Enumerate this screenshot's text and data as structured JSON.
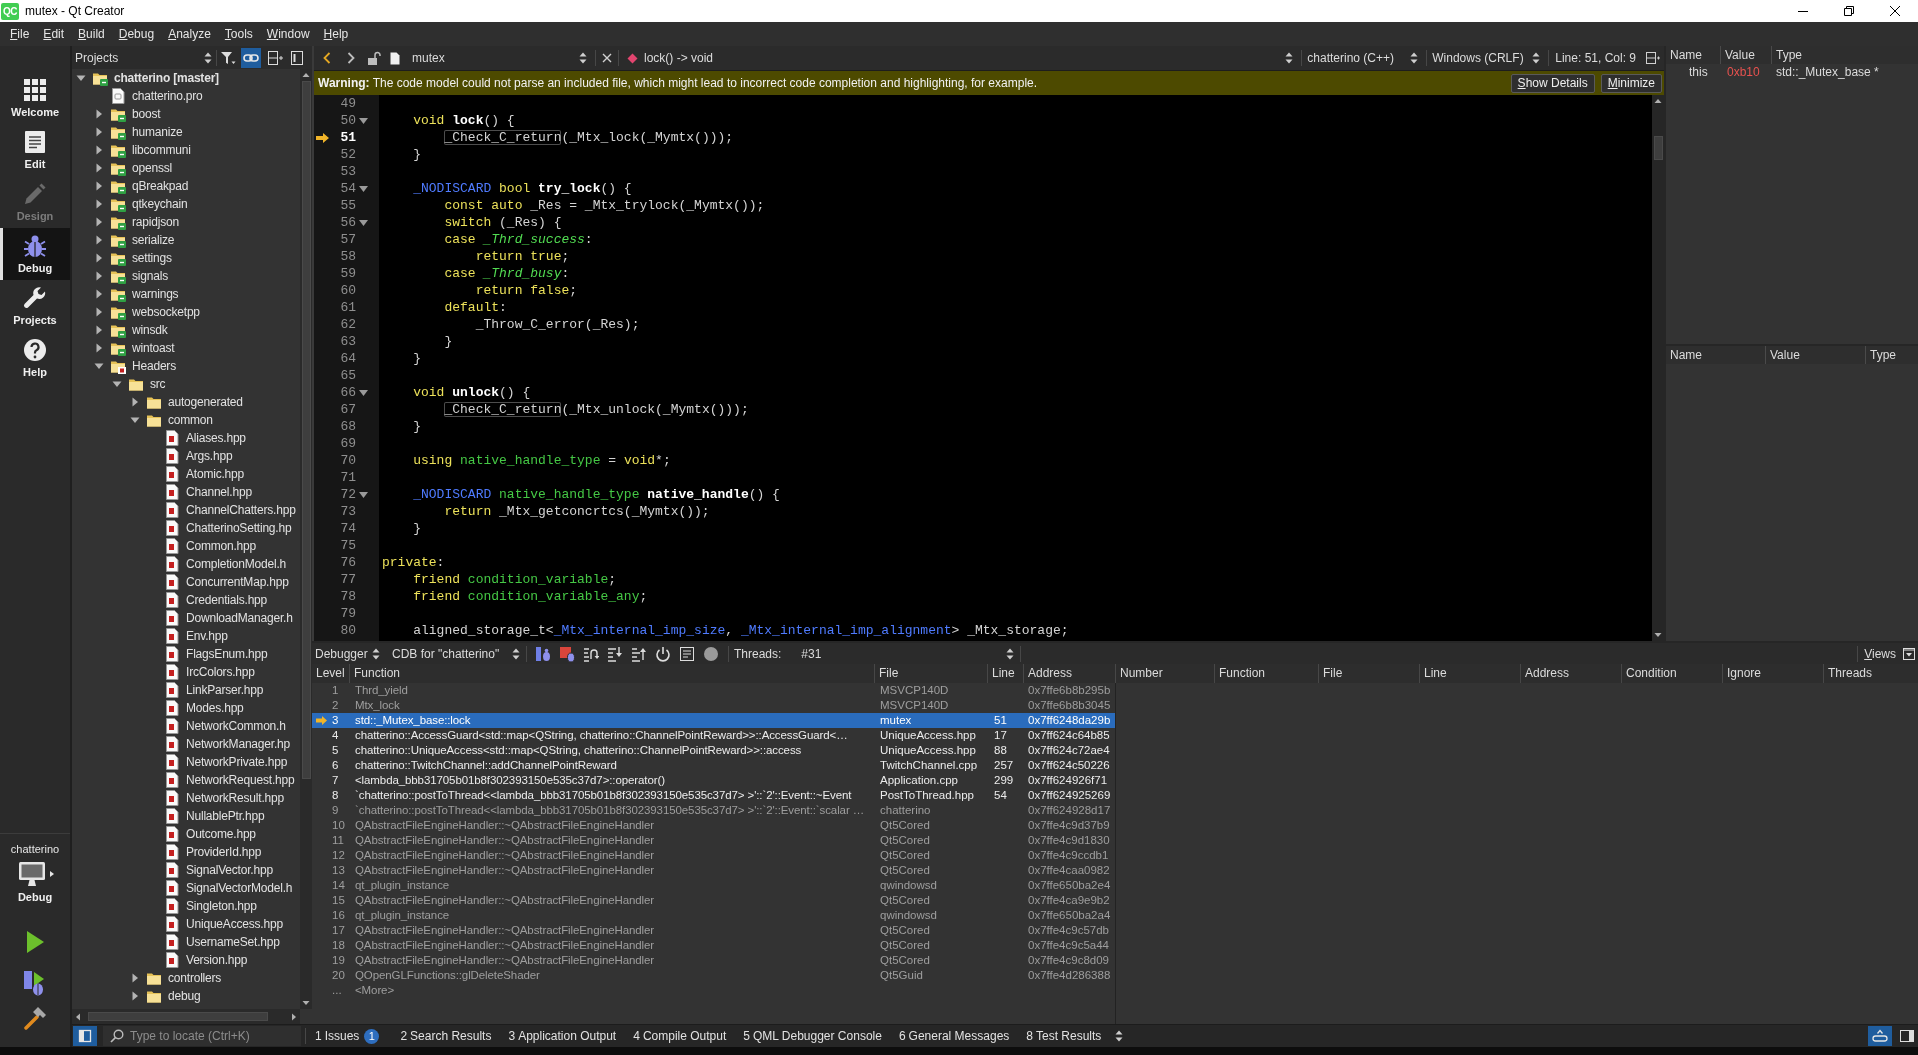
{
  "window": {
    "logo": "QC",
    "title": "mutex - Qt Creator"
  },
  "menu": [
    "File",
    "Edit",
    "Build",
    "Debug",
    "Analyze",
    "Tools",
    "Window",
    "Help"
  ],
  "modes": [
    {
      "kind": "welcome",
      "label": "Welcome",
      "selected": false,
      "disabled": false
    },
    {
      "kind": "edit",
      "label": "Edit",
      "selected": false,
      "disabled": false
    },
    {
      "kind": "design",
      "label": "Design",
      "selected": false,
      "disabled": true
    },
    {
      "kind": "debug",
      "label": "Debug",
      "selected": true,
      "disabled": false
    },
    {
      "kind": "projects",
      "label": "Projects",
      "selected": false,
      "disabled": false
    },
    {
      "kind": "help",
      "label": "Help",
      "selected": false,
      "disabled": false
    }
  ],
  "target": {
    "project": "chatterino",
    "build": "Debug"
  },
  "projects": {
    "view": "Projects",
    "link_with_editor": true,
    "tree": [
      {
        "label": "chatterino [master]",
        "kind": "project",
        "expanded": true,
        "children": [
          {
            "label": "chatterino.pro",
            "kind": "pro-file"
          },
          {
            "label": "boost",
            "kind": "project",
            "expanded": false
          },
          {
            "label": "humanize",
            "kind": "project",
            "expanded": false
          },
          {
            "label": "libcommuni",
            "kind": "project",
            "expanded": false
          },
          {
            "label": "openssl",
            "kind": "project",
            "expanded": false
          },
          {
            "label": "qBreakpad",
            "kind": "project",
            "expanded": false
          },
          {
            "label": "qtkeychain",
            "kind": "project",
            "expanded": false
          },
          {
            "label": "rapidjson",
            "kind": "project",
            "expanded": false
          },
          {
            "label": "serialize",
            "kind": "project",
            "expanded": false
          },
          {
            "label": "settings",
            "kind": "project",
            "expanded": false
          },
          {
            "label": "signals",
            "kind": "project",
            "expanded": false
          },
          {
            "label": "warnings",
            "kind": "project",
            "expanded": false
          },
          {
            "label": "websocketpp",
            "kind": "project",
            "expanded": false
          },
          {
            "label": "winsdk",
            "kind": "project",
            "expanded": false
          },
          {
            "label": "wintoast",
            "kind": "project",
            "expanded": false
          },
          {
            "label": "Headers",
            "kind": "headers",
            "expanded": true,
            "children": [
              {
                "label": "src",
                "kind": "folder",
                "expanded": true,
                "children": [
                  {
                    "label": "autogenerated",
                    "kind": "folder",
                    "expanded": false
                  },
                  {
                    "label": "common",
                    "kind": "folder",
                    "expanded": true,
                    "children": [
                      {
                        "label": "Aliases.hpp",
                        "kind": "header"
                      },
                      {
                        "label": "Args.hpp",
                        "kind": "header"
                      },
                      {
                        "label": "Atomic.hpp",
                        "kind": "header"
                      },
                      {
                        "label": "Channel.hpp",
                        "kind": "header"
                      },
                      {
                        "label": "ChannelChatters.hpp",
                        "kind": "header"
                      },
                      {
                        "label": "ChatterinoSetting.hp",
                        "kind": "header"
                      },
                      {
                        "label": "Common.hpp",
                        "kind": "header"
                      },
                      {
                        "label": "CompletionModel.h",
                        "kind": "header"
                      },
                      {
                        "label": "ConcurrentMap.hpp",
                        "kind": "header"
                      },
                      {
                        "label": "Credentials.hpp",
                        "kind": "header"
                      },
                      {
                        "label": "DownloadManager.h",
                        "kind": "header"
                      },
                      {
                        "label": "Env.hpp",
                        "kind": "header"
                      },
                      {
                        "label": "FlagsEnum.hpp",
                        "kind": "header"
                      },
                      {
                        "label": "IrcColors.hpp",
                        "kind": "header"
                      },
                      {
                        "label": "LinkParser.hpp",
                        "kind": "header"
                      },
                      {
                        "label": "Modes.hpp",
                        "kind": "header"
                      },
                      {
                        "label": "NetworkCommon.h",
                        "kind": "header"
                      },
                      {
                        "label": "NetworkManager.hp",
                        "kind": "header"
                      },
                      {
                        "label": "NetworkPrivate.hpp",
                        "kind": "header"
                      },
                      {
                        "label": "NetworkRequest.hpp",
                        "kind": "header"
                      },
                      {
                        "label": "NetworkResult.hpp",
                        "kind": "header"
                      },
                      {
                        "label": "NullablePtr.hpp",
                        "kind": "header"
                      },
                      {
                        "label": "Outcome.hpp",
                        "kind": "header"
                      },
                      {
                        "label": "ProviderId.hpp",
                        "kind": "header"
                      },
                      {
                        "label": "SignalVector.hpp",
                        "kind": "header"
                      },
                      {
                        "label": "SignalVectorModel.h",
                        "kind": "header"
                      },
                      {
                        "label": "Singleton.hpp",
                        "kind": "header"
                      },
                      {
                        "label": "UniqueAccess.hpp",
                        "kind": "header"
                      },
                      {
                        "label": "UsernameSet.hpp",
                        "kind": "header"
                      },
                      {
                        "label": "Version.hpp",
                        "kind": "header"
                      }
                    ]
                  },
                  {
                    "label": "controllers",
                    "kind": "folder",
                    "expanded": false
                  },
                  {
                    "label": "debug",
                    "kind": "folder",
                    "expanded": false
                  }
                ]
              }
            ]
          }
        ]
      }
    ]
  },
  "editor": {
    "file": "mutex",
    "symbol": "lock() -> void",
    "language": "chatterino (C++)",
    "line_endings": "Windows (CRLF)",
    "position": "Line: 51, Col: 9",
    "warning": {
      "message": "**Warning:** The code model could not parse an included file, which might lead to incorrect code completion and highlighting, for example.",
      "buttons": [
        "Show Details",
        "Minimize"
      ]
    },
    "lines": [
      {
        "number": "49",
        "fold": false,
        "current": false
      },
      {
        "number": "50",
        "fold": true,
        "current": false,
        "tokens": [
          {
            "text": "    void ",
            "kind": "keyword"
          },
          {
            "text": "lock",
            "kind": "function"
          },
          {
            "text": "() {",
            "kind": "plain"
          }
        ]
      },
      {
        "number": "51",
        "fold": false,
        "current": true,
        "tokens": [
          {
            "text": "        _Check_C_return",
            "kind": "boxed"
          },
          {
            "text": "(_Mtx_lock(_Mymtx()));",
            "kind": "plain"
          }
        ]
      },
      {
        "number": "52",
        "fold": false,
        "current": false,
        "tokens": [
          {
            "text": "    }",
            "kind": "plain"
          }
        ]
      },
      {
        "number": "53",
        "fold": false,
        "current": false
      },
      {
        "number": "54",
        "fold": true,
        "current": false,
        "tokens": [
          {
            "text": "    _NODISCARD",
            "kind": "macro"
          },
          {
            "text": " bool ",
            "kind": "keyword"
          },
          {
            "text": "try_lock",
            "kind": "function"
          },
          {
            "text": "() {",
            "kind": "plain"
          }
        ]
      },
      {
        "number": "55",
        "fold": false,
        "current": false,
        "tokens": [
          {
            "text": "        const auto ",
            "kind": "keyword"
          },
          {
            "text": "_Res = _Mtx_trylock(_Mymtx());",
            "kind": "plain"
          }
        ]
      },
      {
        "number": "56",
        "fold": true,
        "current": false,
        "tokens": [
          {
            "text": "        switch",
            "kind": "keyword"
          },
          {
            "text": " (_Res) {",
            "kind": "plain"
          }
        ]
      },
      {
        "number": "57",
        "fold": false,
        "current": false,
        "tokens": [
          {
            "text": "        case ",
            "kind": "keyword"
          },
          {
            "text": "_Thrd_success",
            "kind": "enum"
          },
          {
            "text": ":",
            "kind": "plain"
          }
        ]
      },
      {
        "number": "58",
        "fold": false,
        "current": false,
        "tokens": [
          {
            "text": "            return true",
            "kind": "keyword"
          },
          {
            "text": ";",
            "kind": "plain"
          }
        ]
      },
      {
        "number": "59",
        "fold": false,
        "current": false,
        "tokens": [
          {
            "text": "        case ",
            "kind": "keyword"
          },
          {
            "text": "_Thrd_busy",
            "kind": "enum"
          },
          {
            "text": ":",
            "kind": "plain"
          }
        ]
      },
      {
        "number": "60",
        "fold": false,
        "current": false,
        "tokens": [
          {
            "text": "            return false",
            "kind": "keyword"
          },
          {
            "text": ";",
            "kind": "plain"
          }
        ]
      },
      {
        "number": "61",
        "fold": false,
        "current": false,
        "tokens": [
          {
            "text": "        default",
            "kind": "keyword"
          },
          {
            "text": ":",
            "kind": "plain"
          }
        ]
      },
      {
        "number": "62",
        "fold": false,
        "current": false,
        "tokens": [
          {
            "text": "            _Throw_C_error(_Res);",
            "kind": "plain"
          }
        ]
      },
      {
        "number": "63",
        "fold": false,
        "current": false,
        "tokens": [
          {
            "text": "        }",
            "kind": "plain"
          }
        ]
      },
      {
        "number": "64",
        "fold": false,
        "current": false,
        "tokens": [
          {
            "text": "    }",
            "kind": "plain"
          }
        ]
      },
      {
        "number": "65",
        "fold": false,
        "current": false
      },
      {
        "number": "66",
        "fold": true,
        "current": false,
        "tokens": [
          {
            "text": "    void ",
            "kind": "keyword"
          },
          {
            "text": "unlock",
            "kind": "function"
          },
          {
            "text": "() {",
            "kind": "plain"
          }
        ]
      },
      {
        "number": "67",
        "fold": false,
        "current": false,
        "tokens": [
          {
            "text": "        _Check_C_return",
            "kind": "boxed"
          },
          {
            "text": "(_Mtx_unlock(_Mymtx()));",
            "kind": "plain"
          }
        ]
      },
      {
        "number": "68",
        "fold": false,
        "current": false,
        "tokens": [
          {
            "text": "    }",
            "kind": "plain"
          }
        ]
      },
      {
        "number": "69",
        "fold": false,
        "current": false
      },
      {
        "number": "70",
        "fold": false,
        "current": false,
        "tokens": [
          {
            "text": "    using ",
            "kind": "keyword"
          },
          {
            "text": "native_handle_type",
            "kind": "type"
          },
          {
            "text": " = ",
            "kind": "plain"
          },
          {
            "text": "void",
            "kind": "keyword"
          },
          {
            "text": "*;",
            "kind": "plain"
          }
        ]
      },
      {
        "number": "71",
        "fold": false,
        "current": false
      },
      {
        "number": "72",
        "fold": true,
        "current": false,
        "tokens": [
          {
            "text": "    _NODISCARD",
            "kind": "macro"
          },
          {
            "text": " native_handle_type ",
            "kind": "type"
          },
          {
            "text": "native_handle",
            "kind": "function"
          },
          {
            "text": "() {",
            "kind": "plain"
          }
        ]
      },
      {
        "number": "73",
        "fold": false,
        "current": false,
        "tokens": [
          {
            "text": "        return ",
            "kind": "keyword"
          },
          {
            "text": "_Mtx_getconcrtcs(_Mymtx());",
            "kind": "plain"
          }
        ]
      },
      {
        "number": "74",
        "fold": false,
        "current": false,
        "tokens": [
          {
            "text": "    }",
            "kind": "plain"
          }
        ]
      },
      {
        "number": "75",
        "fold": false,
        "current": false
      },
      {
        "number": "76",
        "fold": false,
        "current": false,
        "tokens": [
          {
            "text": "private",
            "kind": "keyword"
          },
          {
            "text": ":",
            "kind": "plain"
          }
        ]
      },
      {
        "number": "77",
        "fold": false,
        "current": false,
        "tokens": [
          {
            "text": "    friend ",
            "kind": "keyword"
          },
          {
            "text": "condition_variable",
            "kind": "type"
          },
          {
            "text": ";",
            "kind": "plain"
          }
        ]
      },
      {
        "number": "78",
        "fold": false,
        "current": false,
        "tokens": [
          {
            "text": "    friend ",
            "kind": "keyword"
          },
          {
            "text": "condition_variable_any",
            "kind": "type"
          },
          {
            "text": ";",
            "kind": "plain"
          }
        ]
      },
      {
        "number": "79",
        "fold": false,
        "current": false
      },
      {
        "number": "80",
        "fold": false,
        "current": false,
        "tokens": [
          {
            "text": "    aligned_storage_t<",
            "kind": "plain"
          },
          {
            "text": "_Mtx_internal_imp_size",
            "kind": "macro"
          },
          {
            "text": ", ",
            "kind": "plain"
          },
          {
            "text": "_Mtx_internal_imp_alignment",
            "kind": "macro"
          },
          {
            "text": "> _Mtx_storage;",
            "kind": "plain"
          }
        ]
      }
    ]
  },
  "locals": {
    "columns": [
      "Name",
      "Value",
      "Type"
    ],
    "rows": [
      {
        "name": "this",
        "value": "0xb10",
        "type": "std::_Mutex_base *",
        "changed": true
      }
    ]
  },
  "inspector": {
    "columns": [
      "Name",
      "Value",
      "Type"
    ]
  },
  "debugger": {
    "perspective": "Debugger",
    "engine": "CDB for \"chatterino\"",
    "threads_label": "Threads:",
    "thread": "#31",
    "views": "Views",
    "stack": {
      "columns": [
        "Level",
        "Function",
        "File",
        "Line",
        "Address"
      ],
      "frames": [
        {
          "level": "1",
          "function": "Thrd_yield",
          "file": "MSVCP140D",
          "address": "0x7ffe6b8b295b",
          "has_source": false,
          "selected": false,
          "current": false
        },
        {
          "level": "2",
          "function": "Mtx_lock",
          "file": "MSVCP140D",
          "address": "0x7ffe6b8b3045",
          "has_source": false,
          "selected": false,
          "current": false
        },
        {
          "level": "3",
          "function": "std::_Mutex_base::lock",
          "file": "mutex",
          "line": "51",
          "address": "0x7ff6248da29b",
          "has_source": true,
          "selected": true,
          "current": true
        },
        {
          "level": "4",
          "function": "chatterino::AccessGuard<std::map<QString, chatterino::ChannelPointReward>>::AccessGuard<…",
          "file": "UniqueAccess.hpp",
          "line": "17",
          "address": "0x7ff624c64b85",
          "has_source": true,
          "selected": false,
          "current": false
        },
        {
          "level": "5",
          "function": "chatterino::UniqueAccess<std::map<QString, chatterino::ChannelPointReward>>::access",
          "file": "UniqueAccess.hpp",
          "line": "88",
          "address": "0x7ff624c72ae4",
          "has_source": true,
          "selected": false,
          "current": false
        },
        {
          "level": "6",
          "function": "chatterino::TwitchChannel::addChannelPointReward",
          "file": "TwitchChannel.cpp",
          "line": "257",
          "address": "0x7ff624c50226",
          "has_source": true,
          "selected": false,
          "current": false
        },
        {
          "level": "7",
          "function": "<lambda_bbb31705b01b8f302393150e535c37d7>::operator()",
          "file": "Application.cpp",
          "line": "299",
          "address": "0x7ff624926f71",
          "has_source": true,
          "selected": false,
          "current": false
        },
        {
          "level": "8",
          "function": "`chatterino::postToThread<<lambda_bbb31705b01b8f302393150e535c37d7> >'::`2'::Event::~Event",
          "file": "PostToThread.hpp",
          "line": "54",
          "address": "0x7ff624925269",
          "has_source": true,
          "selected": false,
          "current": false
        },
        {
          "level": "9",
          "function": "`chatterino::postToThread<<lambda_bbb31705b01b8f302393150e535c37d7> >'::`2'::Event::`scalar …",
          "file": "chatterino",
          "address": "0x7ff624928d17",
          "has_source": false,
          "selected": false,
          "current": false
        },
        {
          "level": "10",
          "function": "QAbstractFileEngineHandler::~QAbstractFileEngineHandler",
          "file": "Qt5Cored",
          "address": "0x7ffe4c9d37b9",
          "has_source": false,
          "selected": false,
          "current": false
        },
        {
          "level": "11",
          "function": "QAbstractFileEngineHandler::~QAbstractFileEngineHandler",
          "file": "Qt5Cored",
          "address": "0x7ffe4c9d1830",
          "has_source": false,
          "selected": false,
          "current": false
        },
        {
          "level": "12",
          "function": "QAbstractFileEngineHandler::~QAbstractFileEngineHandler",
          "file": "Qt5Cored",
          "address": "0x7ffe4c9ccdb1",
          "has_source": false,
          "selected": false,
          "current": false
        },
        {
          "level": "13",
          "function": "QAbstractFileEngineHandler::~QAbstractFileEngineHandler",
          "file": "Qt5Cored",
          "address": "0x7ffe4caa0982",
          "has_source": false,
          "selected": false,
          "current": false
        },
        {
          "level": "14",
          "function": "qt_plugin_instance",
          "file": "qwindowsd",
          "address": "0x7ffe650ba2e4",
          "has_source": false,
          "selected": false,
          "current": false
        },
        {
          "level": "15",
          "function": "QAbstractFileEngineHandler::~QAbstractFileEngineHandler",
          "file": "Qt5Cored",
          "address": "0x7ffe4ca9e9b2",
          "has_source": false,
          "selected": false,
          "current": false
        },
        {
          "level": "16",
          "function": "qt_plugin_instance",
          "file": "qwindowsd",
          "address": "0x7ffe650ba2a4",
          "has_source": false,
          "selected": false,
          "current": false
        },
        {
          "level": "17",
          "function": "QAbstractFileEngineHandler::~QAbstractFileEngineHandler",
          "file": "Qt5Cored",
          "address": "0x7ffe4c9c57db",
          "has_source": false,
          "selected": false,
          "current": false
        },
        {
          "level": "18",
          "function": "QAbstractFileEngineHandler::~QAbstractFileEngineHandler",
          "file": "Qt5Cored",
          "address": "0x7ffe4c9c5a44",
          "has_source": false,
          "selected": false,
          "current": false
        },
        {
          "level": "19",
          "function": "QAbstractFileEngineHandler::~QAbstractFileEngineHandler",
          "file": "Qt5Cored",
          "address": "0x7ffe4c9c8d09",
          "has_source": false,
          "selected": false,
          "current": false
        },
        {
          "level": "20",
          "function": "QOpenGLFunctions::glDeleteShader",
          "file": "Qt5Guid",
          "address": "0x7ffe4d286388",
          "has_source": false,
          "selected": false,
          "current": false
        },
        {
          "level": "...",
          "function": "<More>",
          "has_source": false,
          "selected": false,
          "current": false
        }
      ]
    },
    "breakpoints": {
      "columns": [
        "Number",
        "Function",
        "File",
        "Line",
        "Address",
        "Condition",
        "Ignore",
        "Threads"
      ]
    }
  },
  "output": {
    "left_sidebar_on": true,
    "locate_placeholder": "Type to locate (Ctrl+K)",
    "tabs": [
      {
        "number": "1",
        "label": "Issues",
        "badge": "1"
      },
      {
        "number": "2",
        "label": "Search Results"
      },
      {
        "number": "3",
        "label": "Application Output"
      },
      {
        "number": "4",
        "label": "Compile Output"
      },
      {
        "number": "5",
        "label": "QML Debugger Console"
      },
      {
        "number": "6",
        "label": "General Messages"
      },
      {
        "number": "8",
        "label": "Test Results"
      }
    ],
    "progress_details_on": true,
    "right_sidebar_on": false
  }
}
